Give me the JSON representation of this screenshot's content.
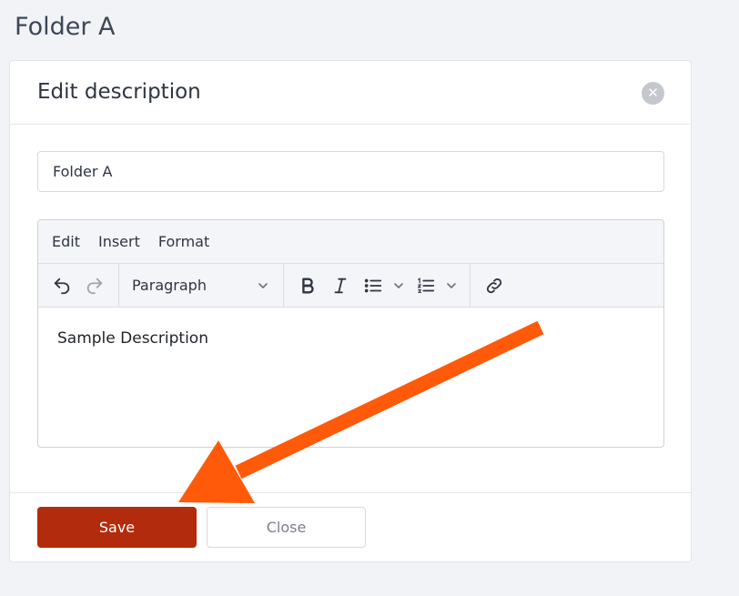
{
  "page": {
    "title": "Folder A"
  },
  "modal": {
    "title": "Edit description",
    "close_icon": "close-circle-icon",
    "name_input_value": "Folder A",
    "editor": {
      "menu": [
        "Edit",
        "Insert",
        "Format"
      ],
      "block_format": "Paragraph",
      "content": "Sample Description",
      "toolbar_icons": [
        "undo-icon",
        "redo-icon",
        "bold-icon",
        "italic-icon",
        "bullet-list-icon",
        "numbered-list-icon",
        "link-icon"
      ]
    },
    "footer": {
      "save_label": "Save",
      "close_label": "Close"
    }
  },
  "colors": {
    "save_button": "#b22b0d",
    "annotation_arrow": "#ff5a0a",
    "page_background": "#f2f3f7"
  }
}
